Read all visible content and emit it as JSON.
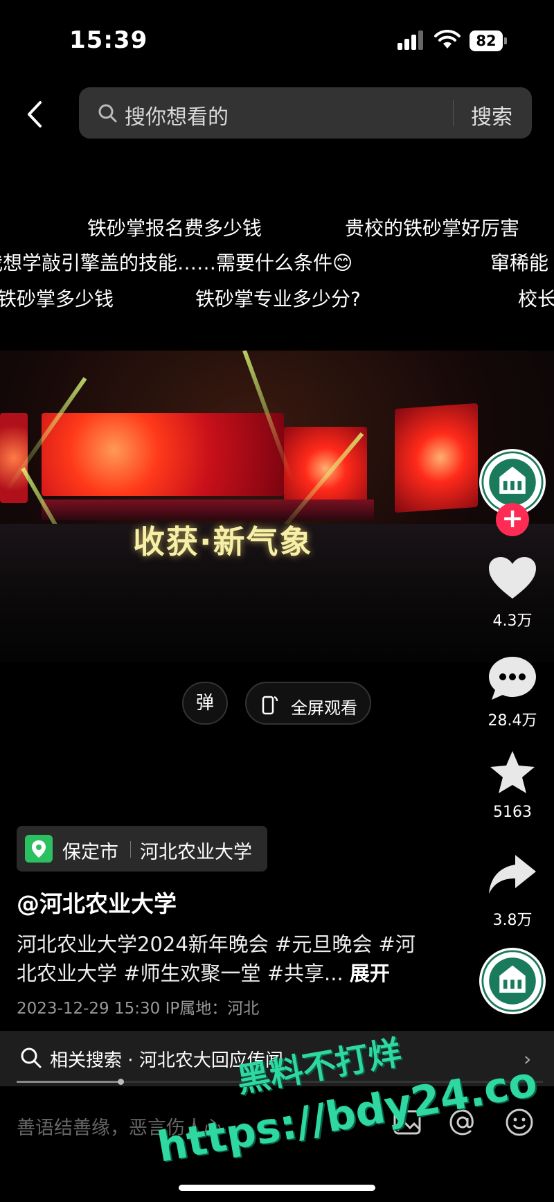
{
  "status_bar": {
    "time": "15:39",
    "battery": "82"
  },
  "search": {
    "placeholder": "搜你想看的",
    "button": "搜索"
  },
  "danmaku": [
    "铁砂掌报名费多少钱",
    "贵校的铁砂掌好厉害",
    "我想学敲引擎盖的技能……需要什么条件😊",
    "窜稀能",
    "铁砂掌多少钱",
    "铁砂掌专业多少分?",
    "校长"
  ],
  "video": {
    "caption": "收获·新气象"
  },
  "controls": {
    "danmaku_toggle": "弹",
    "fullscreen": "全屏观看"
  },
  "actions": {
    "likes": "4.3万",
    "comments": "28.4万",
    "favorites": "5163",
    "shares": "3.8万"
  },
  "location": {
    "city": "保定市",
    "place": "河北农业大学"
  },
  "post": {
    "author": "@河北农业大学",
    "desc_line1": "河北农业大学2024新年晚会 #元旦晚会 #河",
    "desc_line2": "北农业大学 #师生欢聚一堂 #共享...",
    "expand": "展开",
    "meta": "2023-12-29 15:30  IP属地：河北"
  },
  "related": {
    "prefix": "相关搜索",
    "query": "河北农大回应传闻"
  },
  "comment": {
    "placeholder": "善语结善缘，恶言伤人心"
  },
  "watermark": {
    "line1": "黑料不打烊",
    "line2": "https://bdy24.co"
  },
  "colors": {
    "accent": "#fe2c55",
    "location_green": "#2bc160",
    "watermark": "#2ed8a0"
  }
}
